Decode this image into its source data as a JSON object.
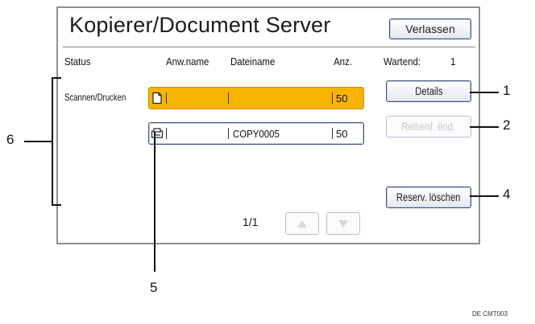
{
  "screen": {
    "title": "Kopierer/Document Server",
    "exit_label": "Verlassen"
  },
  "columns": {
    "status": "Status",
    "user": "Anw.name",
    "file": "Dateiname",
    "qty": "Anz.",
    "waiting_label": "Wartend:",
    "waiting_count": "1"
  },
  "job_group_label": "Scannen/Drucken",
  "jobs": [
    {
      "icon": "print-document-icon",
      "user": "",
      "filename": "",
      "quantity": "50",
      "selected": true
    },
    {
      "icon": "copy-document-icon",
      "user": "",
      "filename": "COPY0005",
      "quantity": "50",
      "selected": false
    }
  ],
  "buttons": {
    "details": "Details",
    "reorder": "Reihenf. ënd.",
    "delete_reservation": "Reserv. löschen"
  },
  "pagination": {
    "text": "1/1",
    "up_icon": "triangle-up-icon",
    "down_icon": "triangle-down-icon"
  },
  "callouts": [
    "1",
    "2",
    "4",
    "5",
    "6"
  ],
  "footer_code": "DE CMT003"
}
